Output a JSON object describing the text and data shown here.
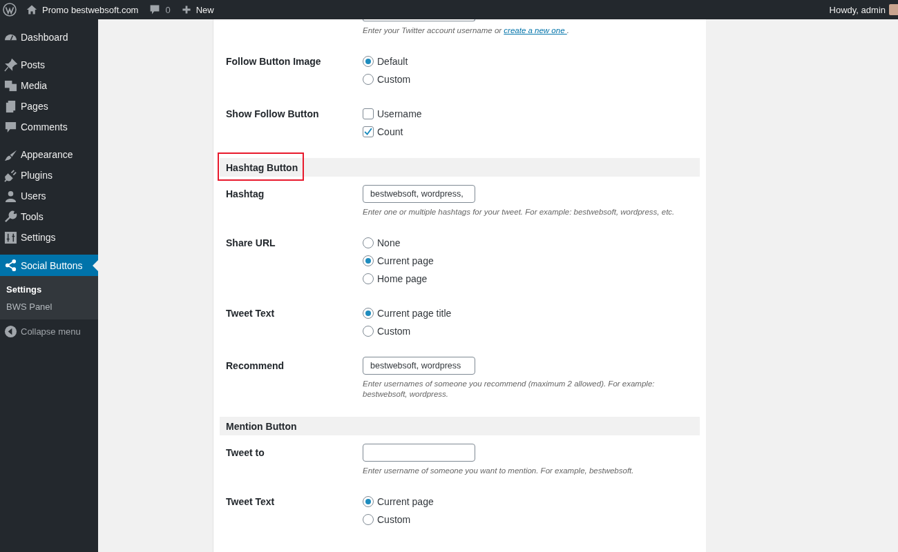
{
  "admin_bar": {
    "site_name": "Promo bestwebsoft.com",
    "comments_count": "0",
    "new_label": "New",
    "greeting": "Howdy, admin"
  },
  "sidebar": {
    "groups": [
      [
        {
          "label": "Dashboard",
          "selected": false
        }
      ],
      [
        {
          "label": "Posts",
          "selected": false
        },
        {
          "label": "Media",
          "selected": false
        },
        {
          "label": "Pages",
          "selected": false
        },
        {
          "label": "Comments",
          "selected": false
        }
      ],
      [
        {
          "label": "Appearance",
          "selected": false
        },
        {
          "label": "Plugins",
          "selected": false
        },
        {
          "label": "Users",
          "selected": false
        },
        {
          "label": "Tools",
          "selected": false
        },
        {
          "label": "Settings",
          "selected": false
        }
      ],
      [
        {
          "label": "Social Buttons",
          "selected": true,
          "children": [
            {
              "label": "Settings",
              "selected": true
            },
            {
              "label": "BWS Panel",
              "selected": false
            }
          ]
        }
      ]
    ],
    "collapse_label": "Collapse menu"
  },
  "sections": [
    {
      "rows": [
        {
          "kind": "text",
          "partial": true,
          "value": "",
          "description": "Enter your Twitter account username or ",
          "link": "create a new one ",
          "description_end": "."
        },
        {
          "kind": "radio",
          "label": "Follow Button Image",
          "options": [
            {
              "label": "Default",
              "selected": true
            },
            {
              "label": "Custom",
              "selected": false
            }
          ]
        },
        {
          "kind": "checkbox",
          "label": "Show Follow Button",
          "options": [
            {
              "label": "Username",
              "checked": false
            },
            {
              "label": "Count",
              "checked": true
            }
          ]
        }
      ]
    },
    {
      "heading": "Hashtag Button",
      "highlighted": true,
      "rows": [
        {
          "kind": "text",
          "label": "Hashtag",
          "value": "bestwebsoft, wordpress,",
          "description": "Enter one or multiple hashtags for your tweet. For example: bestwebsoft, wordpress, etc."
        },
        {
          "kind": "radio",
          "label": "Share URL",
          "options": [
            {
              "label": "None",
              "selected": false
            },
            {
              "label": "Current page",
              "selected": true
            },
            {
              "label": "Home page",
              "selected": false
            }
          ]
        },
        {
          "kind": "radio",
          "label": "Tweet Text",
          "options": [
            {
              "label": "Current page title",
              "selected": true
            },
            {
              "label": "Custom",
              "selected": false
            }
          ]
        },
        {
          "kind": "text",
          "label": "Recommend",
          "value": "bestwebsoft, wordpress",
          "description": "Enter usernames of someone you recommend (maximum 2 allowed). For example: bestwebsoft, wordpress."
        }
      ]
    },
    {
      "heading": "Mention Button",
      "highlighted": false,
      "rows": [
        {
          "kind": "text",
          "label": "Tweet to",
          "value": "",
          "description": "Enter username of someone you want to mention. For example, bestwebsoft."
        },
        {
          "kind": "radio",
          "label": "Tweet Text",
          "options": [
            {
              "label": "Current page",
              "selected": true
            },
            {
              "label": "Custom",
              "selected": false
            }
          ]
        }
      ]
    }
  ]
}
